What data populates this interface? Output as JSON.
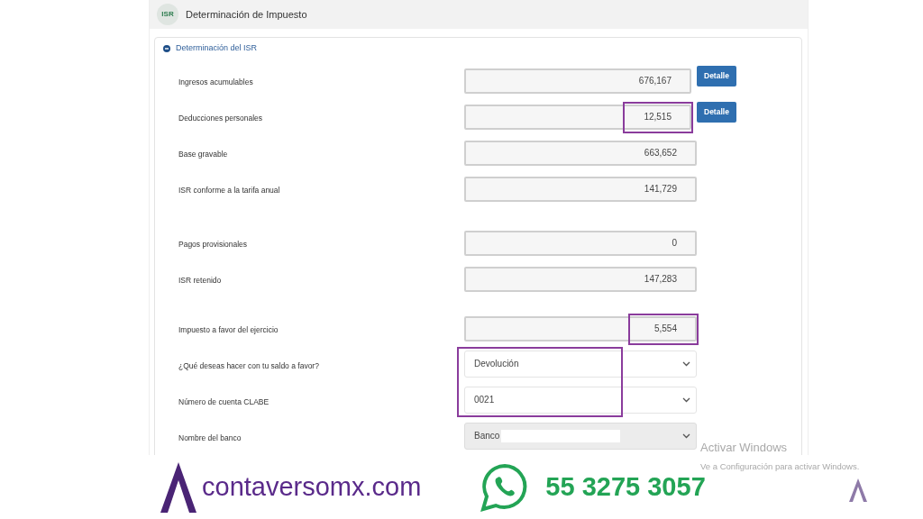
{
  "header": {
    "badge": "ISR",
    "title": "Determinación de Impuesto"
  },
  "section": {
    "title": "Determinación del ISR",
    "expanded": true,
    "groups": [
      [
        {
          "label": "Ingresos acumulables",
          "kind": "input",
          "value": "676,167",
          "button": "Detalle",
          "highlighted": false
        },
        {
          "label": "Deducciones personales",
          "kind": "input",
          "value": "12,515",
          "button": "Detalle",
          "highlighted": true
        },
        {
          "label": "Base gravable",
          "kind": "input",
          "value": "663,652",
          "highlighted": false
        },
        {
          "label": "ISR conforme a la tarifa anual",
          "kind": "input",
          "value": "141,729",
          "highlighted": false
        }
      ],
      [
        {
          "label": "Pagos provisionales",
          "kind": "input",
          "value": "0",
          "highlighted": false
        },
        {
          "label": "ISR retenido",
          "kind": "input",
          "value": "147,283",
          "highlighted": false
        }
      ],
      [
        {
          "label": "Impuesto a favor del ejercicio",
          "kind": "input",
          "value": "5,554",
          "highlighted": true
        },
        {
          "label": "¿Qué deseas hacer con tu saldo a favor?",
          "kind": "select",
          "value": "Devolución",
          "disabled": false,
          "highlighted": true
        },
        {
          "label": "Número de cuenta CLABE",
          "kind": "select",
          "value": "0021",
          "disabled": false,
          "highlighted": true
        },
        {
          "label": "Nombre del banco",
          "kind": "select",
          "value": "Banco",
          "disabled": true,
          "highlighted": false,
          "redacted": true
        }
      ]
    ]
  },
  "windows_notice": {
    "title": "Activar Windows",
    "text": "Ve a Configuración para activar Windows."
  },
  "banner": {
    "website": "contaversomx.com",
    "phone": "55 3275 3057"
  }
}
